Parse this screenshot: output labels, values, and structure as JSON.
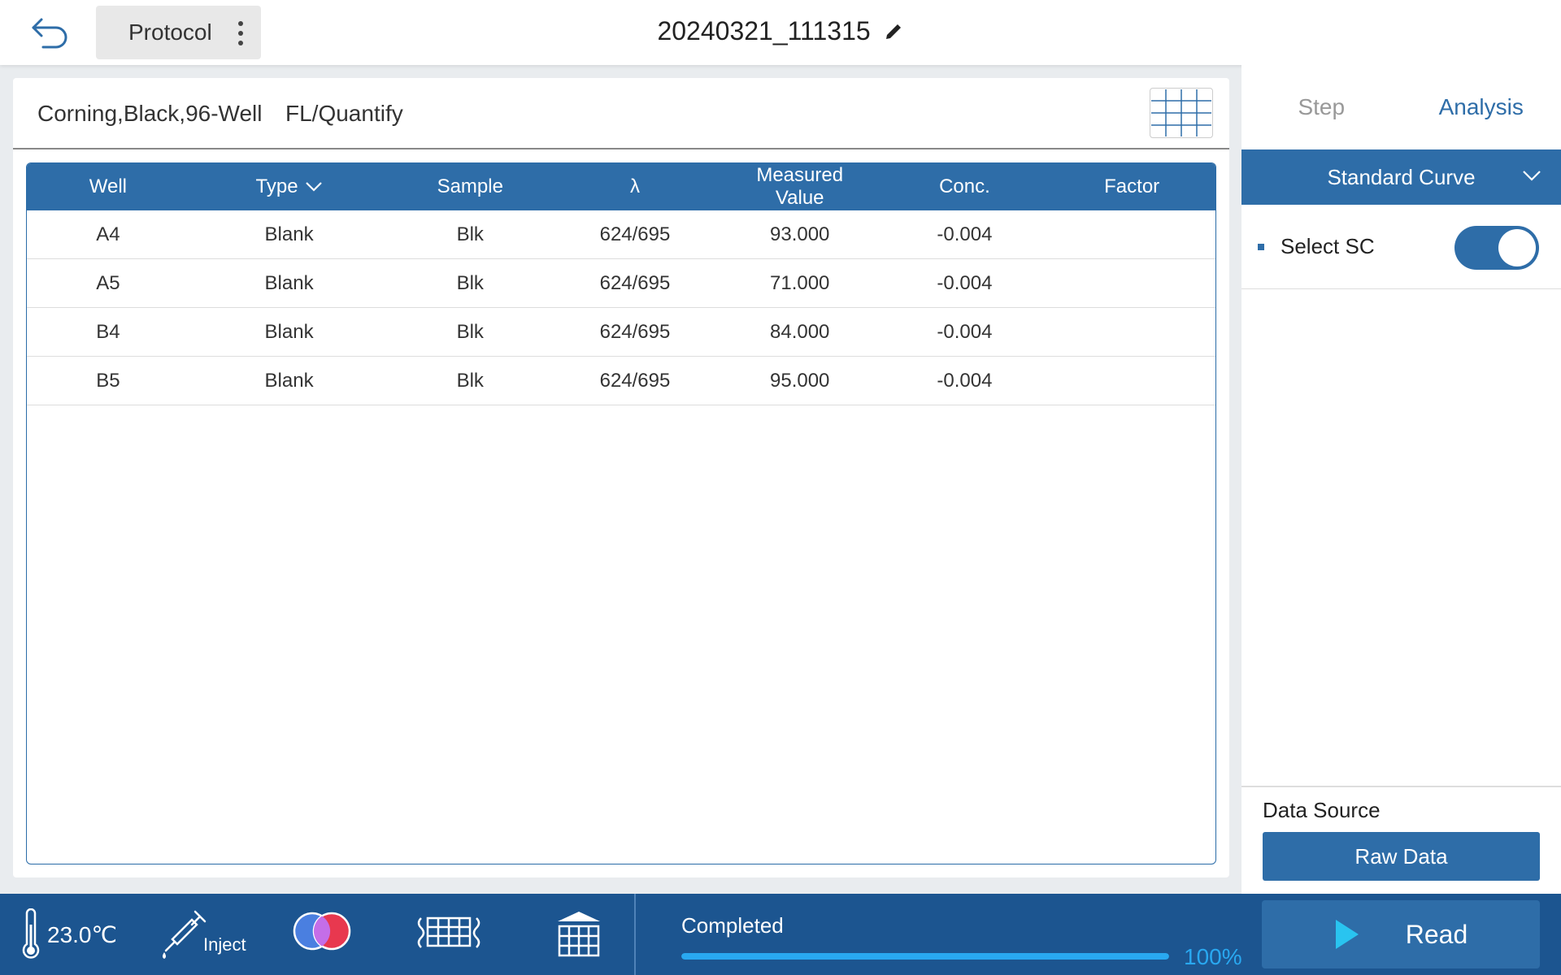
{
  "header": {
    "protocol_label": "Protocol",
    "title": "20240321_111315"
  },
  "main": {
    "plate": "Corning,Black,96-Well",
    "mode": "FL/Quantify",
    "table": {
      "columns": [
        "Well",
        "Type",
        "Sample",
        "λ",
        "Measured\nValue",
        "Conc.",
        "Factor"
      ],
      "rows": [
        {
          "well": "A4",
          "type": "Blank",
          "sample": "Blk",
          "lambda": "624/695",
          "measured": "93.000",
          "conc": "-0.004",
          "factor": ""
        },
        {
          "well": "A5",
          "type": "Blank",
          "sample": "Blk",
          "lambda": "624/695",
          "measured": "71.000",
          "conc": "-0.004",
          "factor": ""
        },
        {
          "well": "B4",
          "type": "Blank",
          "sample": "Blk",
          "lambda": "624/695",
          "measured": "84.000",
          "conc": "-0.004",
          "factor": ""
        },
        {
          "well": "B5",
          "type": "Blank",
          "sample": "Blk",
          "lambda": "624/695",
          "measured": "95.000",
          "conc": "-0.004",
          "factor": ""
        }
      ]
    }
  },
  "right_panel": {
    "tabs": [
      "Step",
      "Analysis"
    ],
    "active_tab": "Analysis",
    "analysis_dropdown": "Standard Curve",
    "select_sc_label": "Select SC",
    "select_sc_on": true,
    "data_source_label": "Data Source",
    "data_source_button": "Raw Data"
  },
  "bottom_bar": {
    "temperature": "23.0℃",
    "inject_label": "Inject",
    "status": "Completed",
    "progress_value": 100,
    "progress_label": "100%",
    "read_label": "Read"
  },
  "colors": {
    "primary": "#2e6da8",
    "bottom_bar": "#1c5590",
    "progress": "#29a8f0"
  },
  "icons": {
    "back": "undo-arrow-icon",
    "more": "vertical-dots-icon",
    "edit": "pencil-icon",
    "plate_view": "grid-icon",
    "temperature": "thermometer-icon",
    "inject": "syringe-icon",
    "filters": "color-filter-icon",
    "shake": "plate-shake-icon",
    "incubate": "plate-lid-icon",
    "read": "play-icon"
  }
}
